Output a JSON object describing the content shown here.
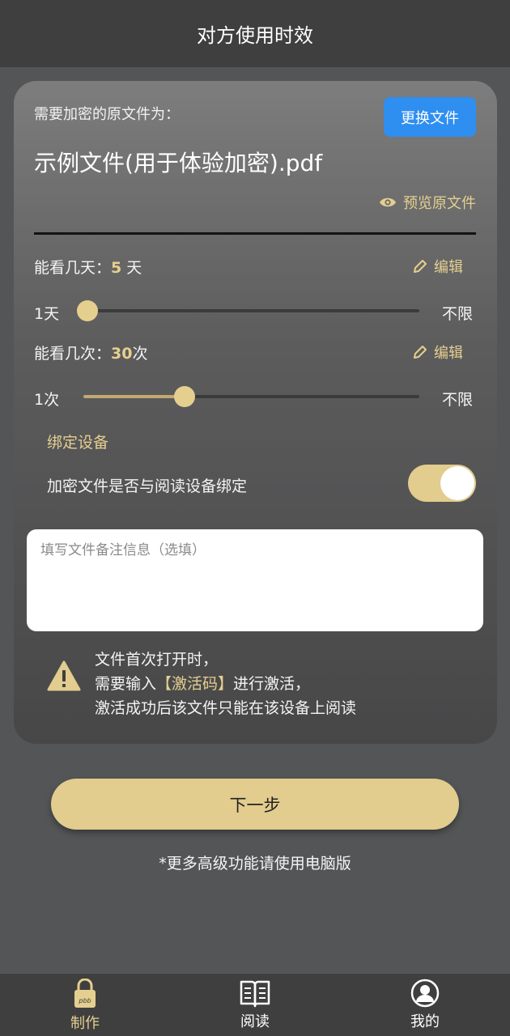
{
  "header": {
    "title": "对方使用时效"
  },
  "file": {
    "label": "需要加密的原文件为：",
    "change_button": "更换文件",
    "name": "示例文件(用于体验加密).pdf",
    "preview_label": "预览原文件"
  },
  "days": {
    "label_prefix": "能看几天：",
    "value": "5",
    "unit": " 天",
    "edit_label": "编辑",
    "slider_min": "1天",
    "slider_max": "不限",
    "slider_fraction": 0.0
  },
  "times": {
    "label_prefix": "能看几次：",
    "value": "30",
    "unit": "次",
    "edit_label": "编辑",
    "slider_min": "1次",
    "slider_max": "不限",
    "slider_fraction": 0.3
  },
  "bind": {
    "section_title": "绑定设备",
    "question": "加密文件是否与阅读设备绑定",
    "enabled": true
  },
  "note": {
    "placeholder": "填写文件备注信息（选填）",
    "value": ""
  },
  "warning": {
    "line1": "文件首次打开时，",
    "line2_prefix": "需要输入",
    "line2_highlight": "【激活码】",
    "line2_suffix": "进行激活，",
    "line3": "激活成功后该文件只能在该设备上阅读"
  },
  "next_button": "下一步",
  "footnote": "*更多高级功能请使用电脑版",
  "tabs": [
    {
      "label": "制作",
      "icon": "lock-pbb-icon",
      "active": true
    },
    {
      "label": "阅读",
      "icon": "book-icon",
      "active": false
    },
    {
      "label": "我的",
      "icon": "user-icon",
      "active": false
    }
  ],
  "colors": {
    "accent": "#e5cf8f",
    "button_blue": "#2f8ff0",
    "active_tab": "#e5cf8f",
    "inactive_tab": "#ffffff"
  }
}
